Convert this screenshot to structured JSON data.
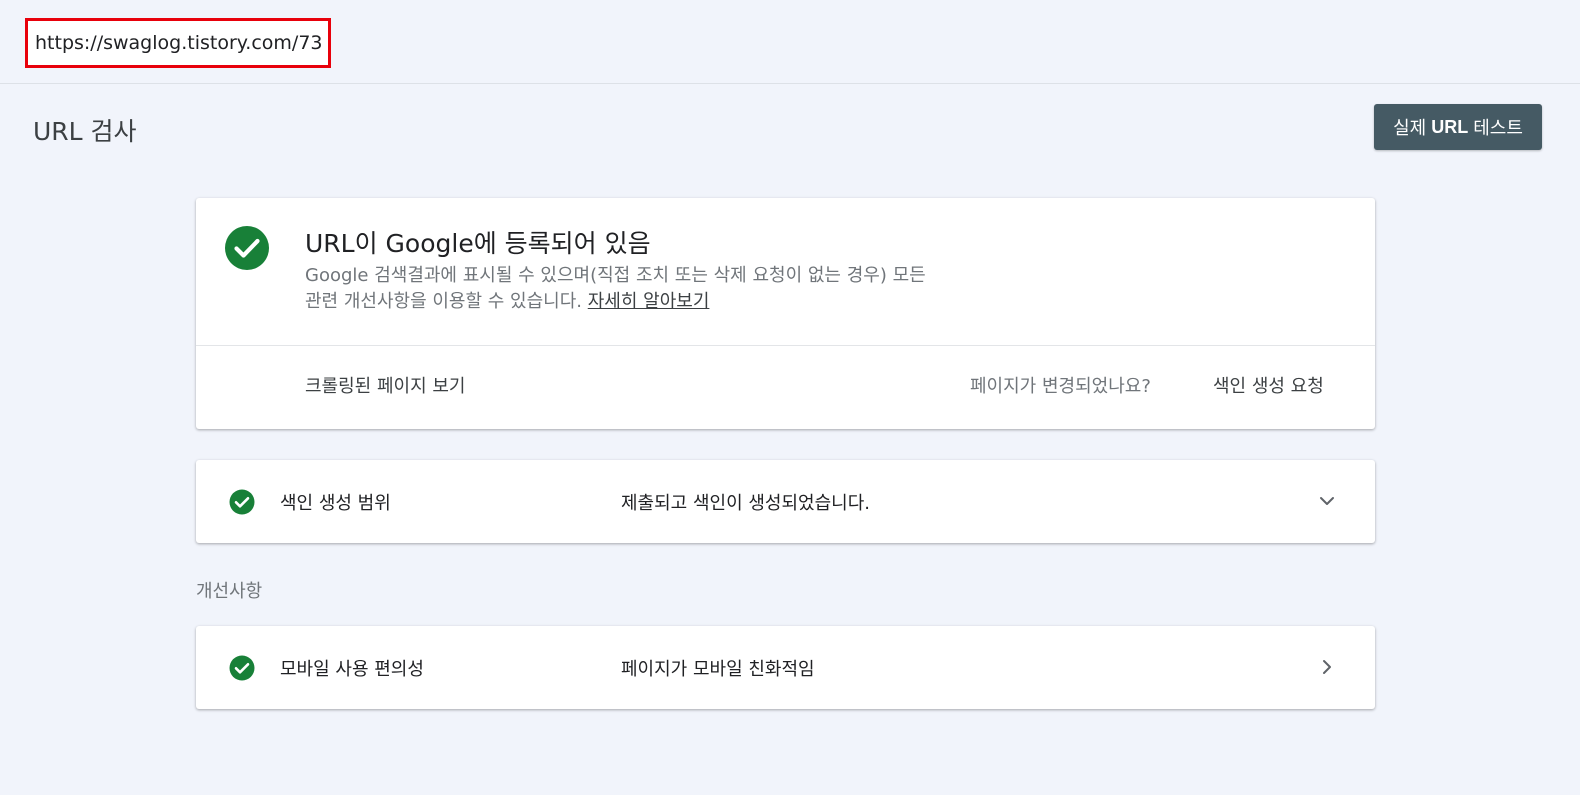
{
  "url_box": {
    "url": "https://swaglog.tistory.com/73"
  },
  "header": {
    "title": "URL 검사",
    "test_button_prefix": "실제 ",
    "test_button_bold": "URL",
    "test_button_suffix": " 테스트"
  },
  "status_card": {
    "title": "URL이 Google에 등록되어 있음",
    "description_line1": "Google 검색결과에 표시될 수 있으며(직접 조치 또는 삭제 요청이 없는 경우) 모든",
    "description_line2": "관련 개선사항을 이용할 수 있습니다. ",
    "learn_more": "자세히 알아보기",
    "view_crawled_page": "크롤링된 페이지 보기",
    "page_changed_prompt": "페이지가 변경되었나요?",
    "request_indexing": "색인 생성 요청"
  },
  "coverage": {
    "label": "색인 생성 범위",
    "value": "제출되고 색인이 생성되었습니다."
  },
  "enhancements": {
    "section_label": "개선사항",
    "items": [
      {
        "label": "모바일 사용 편의성",
        "value": "페이지가 모바일 친화적임"
      }
    ]
  },
  "colors": {
    "success_green": "#188038",
    "button_bg": "#455a64",
    "highlight_red": "#e8000b",
    "page_bg": "#f1f4fb"
  },
  "icons": {
    "status": "check-circle-icon",
    "coverage_expand": "chevron-down-icon",
    "mobile_open": "chevron-right-icon"
  }
}
